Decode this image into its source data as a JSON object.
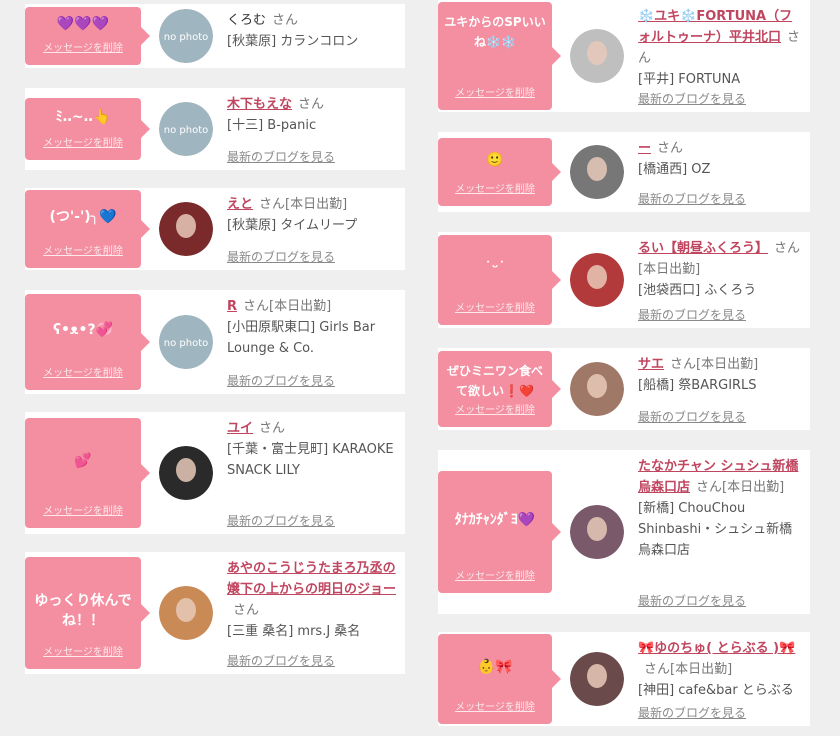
{
  "messages": [
    {
      "bubble": "💜💜💜",
      "name": "くろむ",
      "suffix": "さん",
      "shop": "[秋葉原] カランコロン",
      "plain": true
    },
    {
      "bubble": "ﾐ‥~‥👆",
      "name": "木下もえな",
      "suffix": "さん",
      "shop": "[十三] B-panic",
      "blog": "最新のブログを見る"
    },
    {
      "bubble": "(つ'-')╮💙",
      "name": "えと",
      "suffix": "さん[本日出勤]",
      "shop": "[秋葉原] タイムリープ",
      "blog": "最新のブログを見る"
    },
    {
      "bubble": "ʕ•ᴥ•?💞",
      "name": "R",
      "suffix": "さん[本日出勤]",
      "shop": "[小田原駅東口] Girls Bar Lounge & Co.",
      "blog": "最新のブログを見る"
    },
    {
      "bubble": "💕",
      "name": "ユイ",
      "suffix": "さん",
      "shop": "[千葉・富士見町] KARAOKE SNACK LILY",
      "blog": "最新のブログを見る"
    },
    {
      "bubble": "ゆっくり休んでね！！",
      "name": "あやのこうじうたまろ乃丞の嬢下の上からの明日のジョー",
      "suffix": "さん",
      "shop": "[三重 桑名] mrs.J 桑名",
      "blog": "最新のブログを見る"
    },
    {
      "bubble": "ユキからのSPいいね❄️❄️",
      "name": "❄️ユキ❄️FORTUNA（フォルトゥーナ）平井北口",
      "suffix": "さん",
      "shop": "[平井] FORTUNA",
      "blog": "最新のブログを見る"
    },
    {
      "bubble": "🙂",
      "name": "ー",
      "suffix": "さん",
      "shop": "[橋通西] OZ",
      "blog": "最新のブログを見る"
    },
    {
      "bubble": "˙ᵕ˙",
      "name": "るい【朝昼ふくろう】",
      "suffix": "さん[本日出勤]",
      "shop": "[池袋西口] ふくろう",
      "blog": "最新のブログを見る"
    },
    {
      "bubble": "ぜひミニワン食べて欲しい❗️❤️",
      "name": "サエ",
      "suffix": "さん[本日出勤]",
      "shop": "[船橋] 祭BARGIRLS",
      "blog": "最新のブログを見る"
    },
    {
      "bubble": "ﾀﾅｶﾁｬﾝﾀﾞﾖ💜",
      "name": "たなかチャン シュシュ新橋烏森口店",
      "suffix": "さん[本日出勤]",
      "shop": "[新橋] ChouChou Shinbashi・シュシュ新橋烏森口店",
      "blog": "最新のブログを見る"
    },
    {
      "bubble": "👶🎀",
      "name": "🎀ゆのちゅ( とらぶる )🎀",
      "suffix": "さん[本日出勤]",
      "shop": "[神田] cafe&bar とらぶる",
      "blog": "最新のブログを見る"
    }
  ],
  "delete_label": "メッセージを削除",
  "avatar_text": "no photo",
  "colors": {
    "bubble": "#f38fa0",
    "name": "#c0455f",
    "background": "#efefef"
  }
}
